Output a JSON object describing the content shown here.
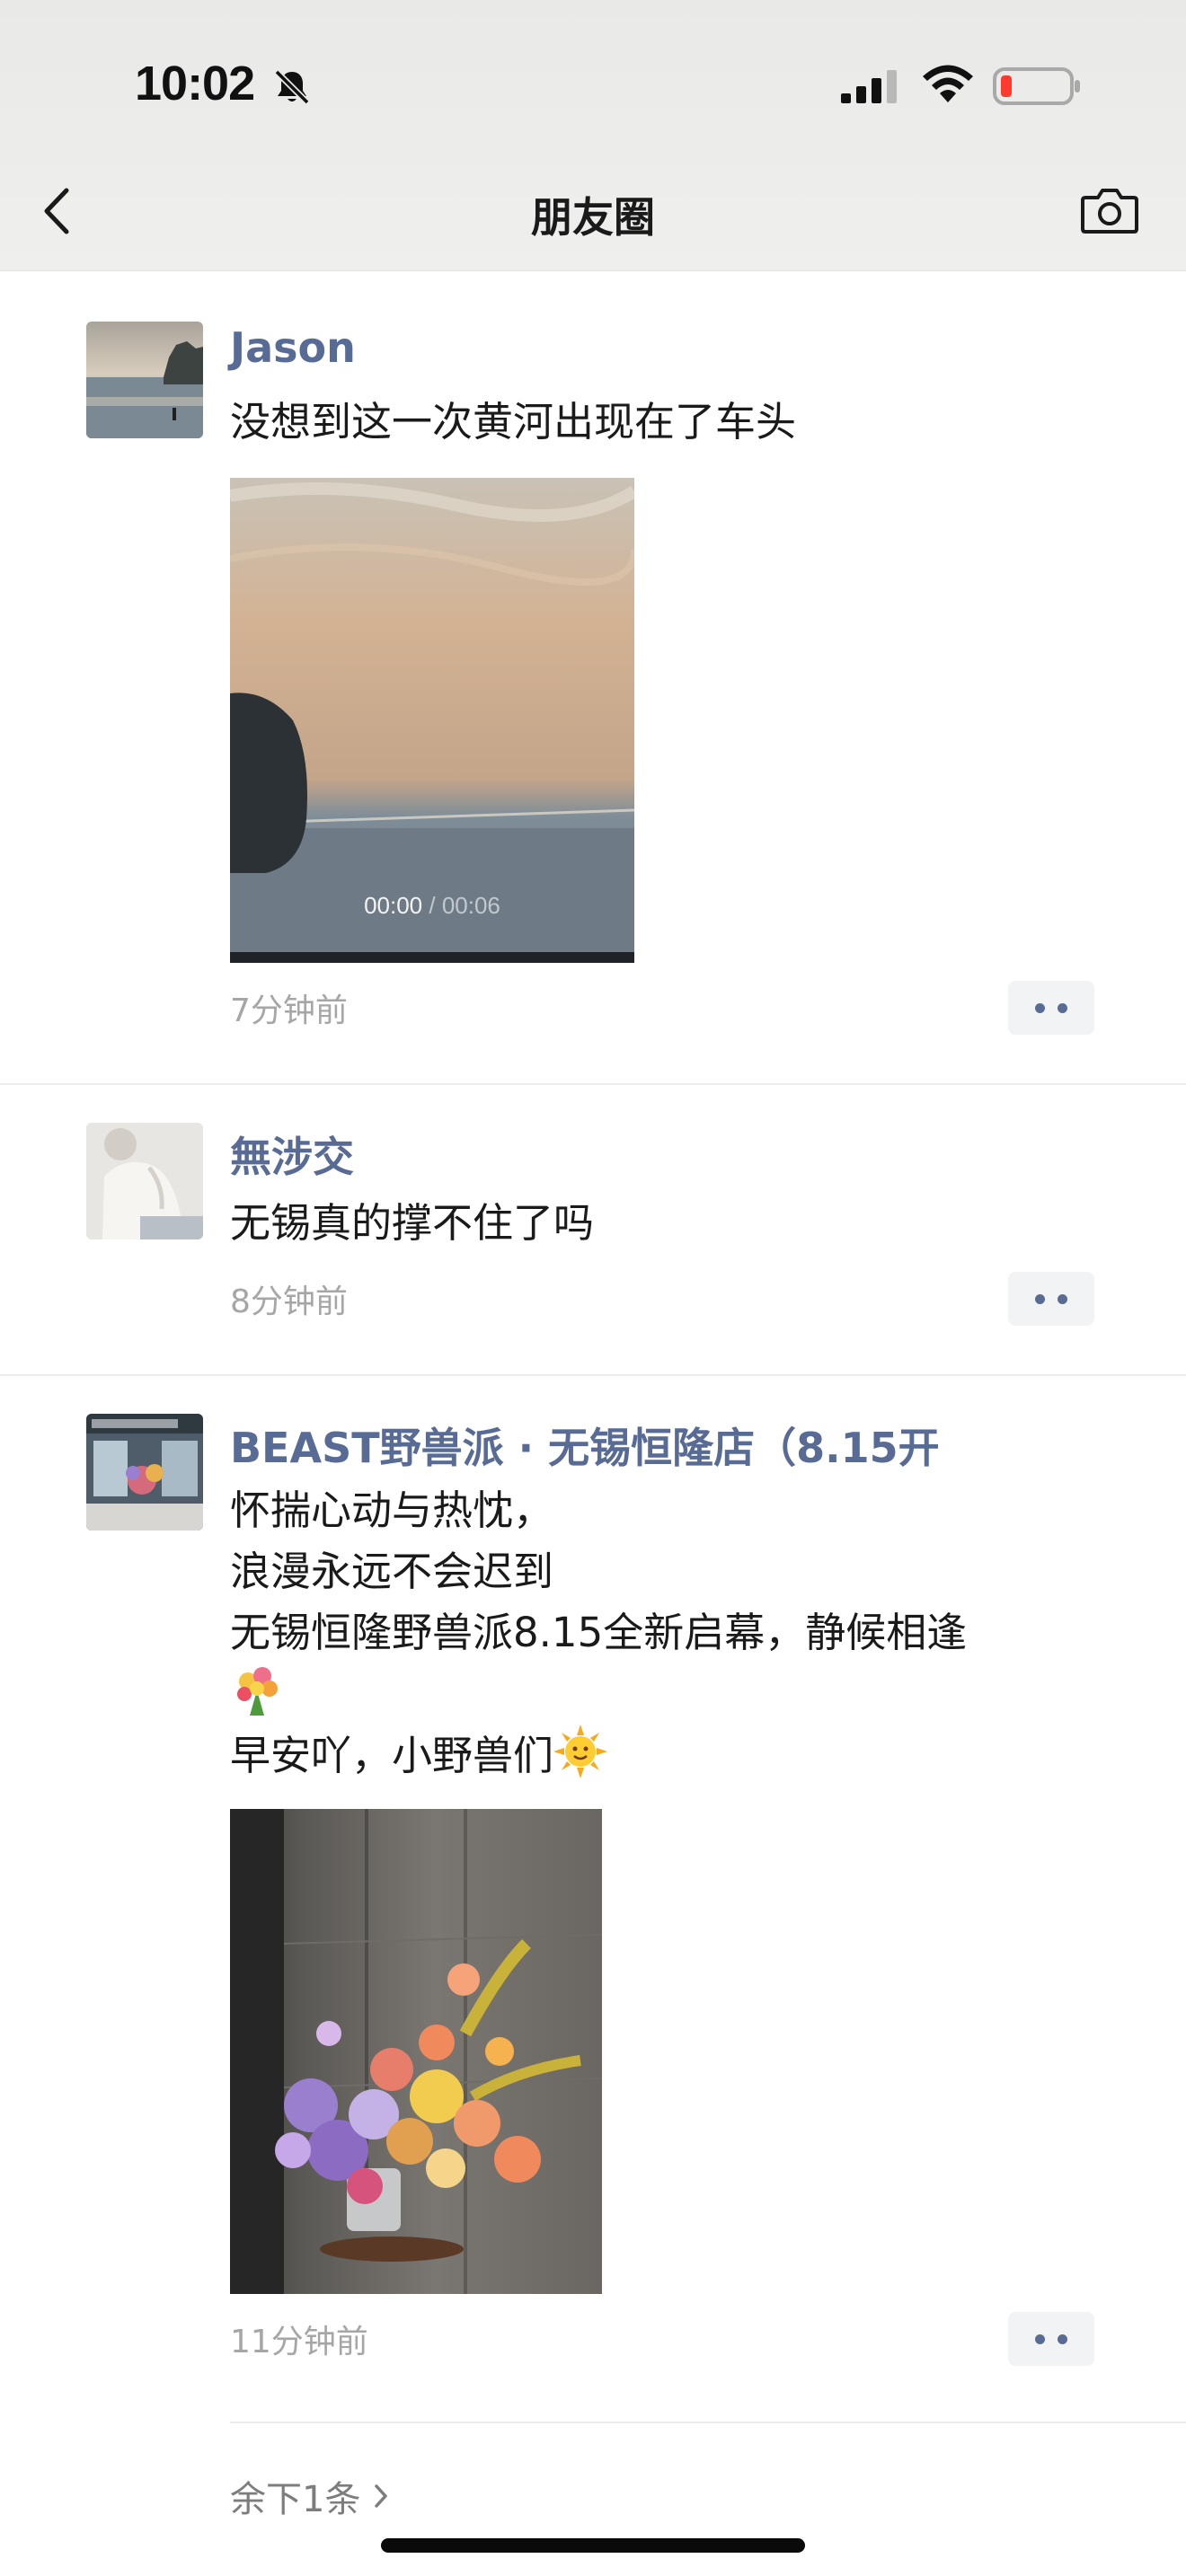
{
  "status_bar": {
    "time": "10:02",
    "icons": [
      "bell-slash-icon",
      "cellular-signal-icon",
      "wifi-icon",
      "battery-low-icon"
    ],
    "battery_color": "#ff3b30"
  },
  "nav": {
    "title": "朋友圈",
    "back_icon": "chevron-left-icon",
    "camera_icon": "camera-icon"
  },
  "colors": {
    "name_blue": "#576b95",
    "time_gray": "#a6a6a6",
    "text": "#1a1a1a"
  },
  "posts": [
    {
      "name": "Jason",
      "text": "没想到这一次黄河出现在了车头",
      "media": {
        "type": "video",
        "current": "00:00",
        "separator": " / ",
        "duration": "00:06"
      },
      "time": "7分钟前"
    },
    {
      "name": "無涉交",
      "text": "无锡真的撑不住了吗",
      "time": "8分钟前"
    },
    {
      "name": "BEAST野兽派 · 无锡恒隆店（8.15开",
      "lines": [
        "怀揣心动与热忱，",
        "浪漫永远不会迟到",
        "无锡恒隆野兽派8.15全新启幕，静候相逢",
        "",
        "早安吖，小野兽们"
      ],
      "emojis": [
        "bouquet-emoji",
        "sun-with-face-emoji"
      ],
      "media": {
        "type": "image",
        "subject": "flower-arrangement"
      },
      "time": "11分钟前"
    }
  ],
  "remaining": {
    "label": "余下1条",
    "icon": "chevron-right-icon"
  }
}
